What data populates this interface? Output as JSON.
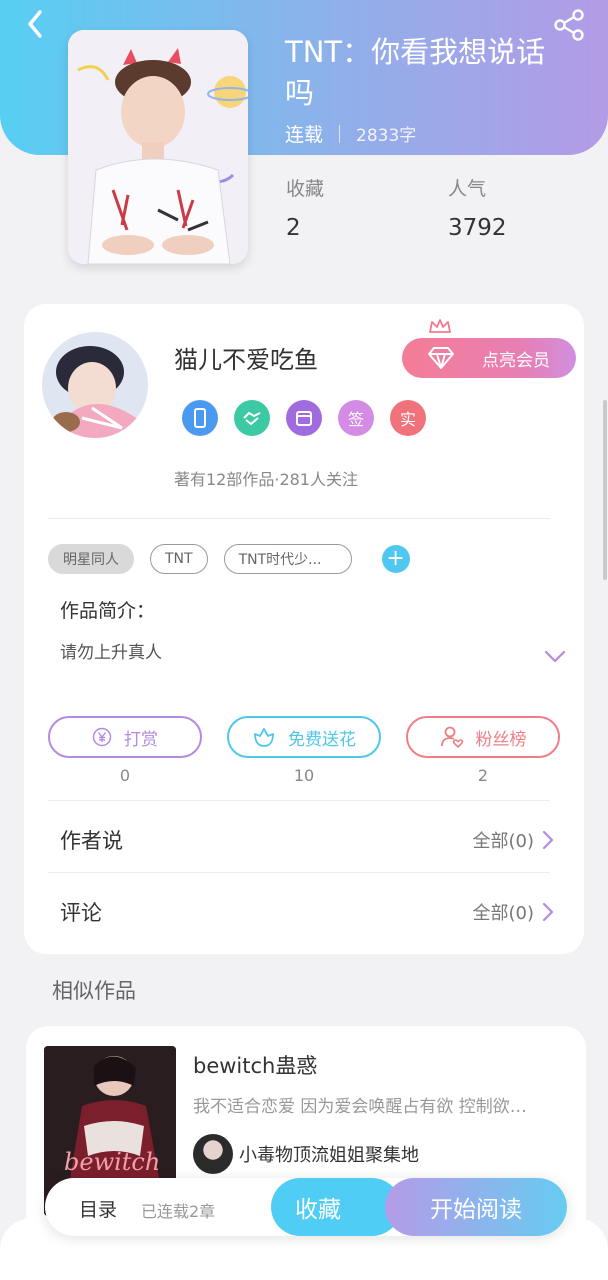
{
  "header": {
    "back_icon": "chevron-left-icon",
    "share_icon": "share-icon"
  },
  "book": {
    "title": "TNT：你看我想说话吗",
    "status": "连载",
    "word_count": "2833字",
    "stats": [
      {
        "label": "收藏",
        "value": "2"
      },
      {
        "label": "人气",
        "value": "3792"
      }
    ]
  },
  "author": {
    "name": "猫儿不爱吃鱼",
    "vip_button": "点亮会员",
    "badges": [
      {
        "icon": "phone-badge-icon",
        "text": "",
        "color": "#4a9bf0"
      },
      {
        "icon": "handshake-badge-icon",
        "text": "",
        "color": "#3cc9a3"
      },
      {
        "icon": "calendar-badge-icon",
        "text": "",
        "color": "#a16be0"
      },
      {
        "icon": "sign-badge-icon",
        "text": "签",
        "color": "#d48be6"
      },
      {
        "icon": "verified-badge-icon",
        "text": "实",
        "color": "#f0727a"
      }
    ],
    "stats_text": "著有12部作品·281人关注"
  },
  "tags": [
    "明星同人",
    "TNT",
    "TNT时代少..."
  ],
  "intro": {
    "label": "作品简介：",
    "text": "请勿上升真人"
  },
  "actions": [
    {
      "label": "打赏",
      "count": "0",
      "icon": "yen-icon",
      "color": "#b58ae0"
    },
    {
      "label": "免费送花",
      "count": "10",
      "icon": "flower-icon",
      "color": "#4fc7e8"
    },
    {
      "label": "粉丝榜",
      "count": "2",
      "icon": "fan-icon",
      "color": "#ee7f86"
    }
  ],
  "rows": [
    {
      "title": "作者说",
      "right": "全部(0)"
    },
    {
      "title": "评论",
      "right": "全部(0)"
    }
  ],
  "similar": {
    "section_title": "相似作品",
    "items": [
      {
        "title": "bewitch蛊惑",
        "desc": "我不适合恋爱 因为爱会唤醒占有欲 控制欲…",
        "author": "小毒物顶流姐姐聚集地",
        "cover_text": "bewitch"
      }
    ]
  },
  "bottom_bar": {
    "toc": "目录",
    "chapters": "已连载2章",
    "favorite": "收藏",
    "read": "开始阅读"
  },
  "colors": {
    "accent_blue": "#4fcdf4",
    "accent_purple": "#b59be8",
    "vip_pink": "#f47d95"
  }
}
